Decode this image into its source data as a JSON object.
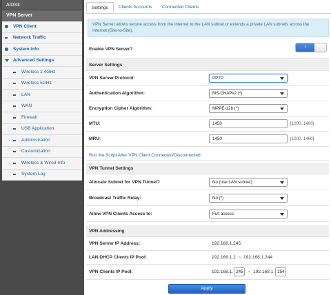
{
  "sidebar": {
    "top_item": "AiDisk",
    "active_item": "VPN Server",
    "items": [
      {
        "label": "VPN Client",
        "icon": "circle-icon",
        "bold": true
      },
      {
        "label": "Network Traffic",
        "icon": "dash-icon",
        "bold": true
      },
      {
        "label": "System Info",
        "icon": "circle-icon",
        "bold": true
      },
      {
        "label": "Advanced Settings",
        "icon": "chevron-down-icon",
        "bold": true
      },
      {
        "label": "Wireless 2.4GHz"
      },
      {
        "label": "Wireless 5GHz"
      },
      {
        "label": "LAN"
      },
      {
        "label": "WAN"
      },
      {
        "label": "Firewall"
      },
      {
        "label": "USB Application"
      },
      {
        "label": "Administration"
      },
      {
        "label": "Customization"
      },
      {
        "label": "Wireless & Wired Info"
      },
      {
        "label": "System Log"
      }
    ]
  },
  "tabs": [
    "Settings",
    "Clients Accounts",
    "Connected Clients"
  ],
  "info_text": "VPN Server allows secure access from the internet to the LAN subnet or extends a private LAN subnets across the Internet (Site-to-Site).",
  "enable": {
    "label": "Enable VPN Server?",
    "toggle_label": "I",
    "state": "on"
  },
  "server_settings": {
    "title": "Server Settings",
    "protocol": {
      "label": "VPN Server Protocol:",
      "value": "PPTP"
    },
    "auth": {
      "label": "Authentication Algorithm:",
      "value": "MS-CHAPv2 (*)"
    },
    "cipher": {
      "label": "Encryption Cipher Algorithm:",
      "value": "MPPE-128 (*)"
    },
    "mtu": {
      "label": "MTU:",
      "value": "1450",
      "hint": "[1000..1460]"
    },
    "mru": {
      "label": "MRU:",
      "value": "1450",
      "hint": "[1000..1460]"
    },
    "script_link": "Run the Script After VPN Client Connected/Disconnected:"
  },
  "tunnel_settings": {
    "title": "VPN Tunnel Settings",
    "subnet": {
      "label": "Allocate Subnet for VPN Tunnel?",
      "value": "No (use LAN subnet)"
    },
    "broadcast": {
      "label": "Broadcast Traffic Relay:",
      "value": "No (*)"
    },
    "access": {
      "label": "Allow VPN Clients Access to:",
      "value": "Full access"
    }
  },
  "addressing": {
    "title": "VPN Addressing",
    "server_ip": {
      "label": "VPN Server IP Address:",
      "value": "192.168.1.245"
    },
    "dhcp_pool": {
      "label": "LAN DHCP Clients IP Pool:",
      "value": "192.168.1.2  ~  192.168.1.244"
    },
    "clients_pool": {
      "label": "VPN Clients IP Pool:",
      "prefix_start": "192.168.1.",
      "start": "245",
      "separator": "~",
      "prefix_end": "192.168.1.",
      "end": "254"
    }
  },
  "apply_label": "Apply"
}
